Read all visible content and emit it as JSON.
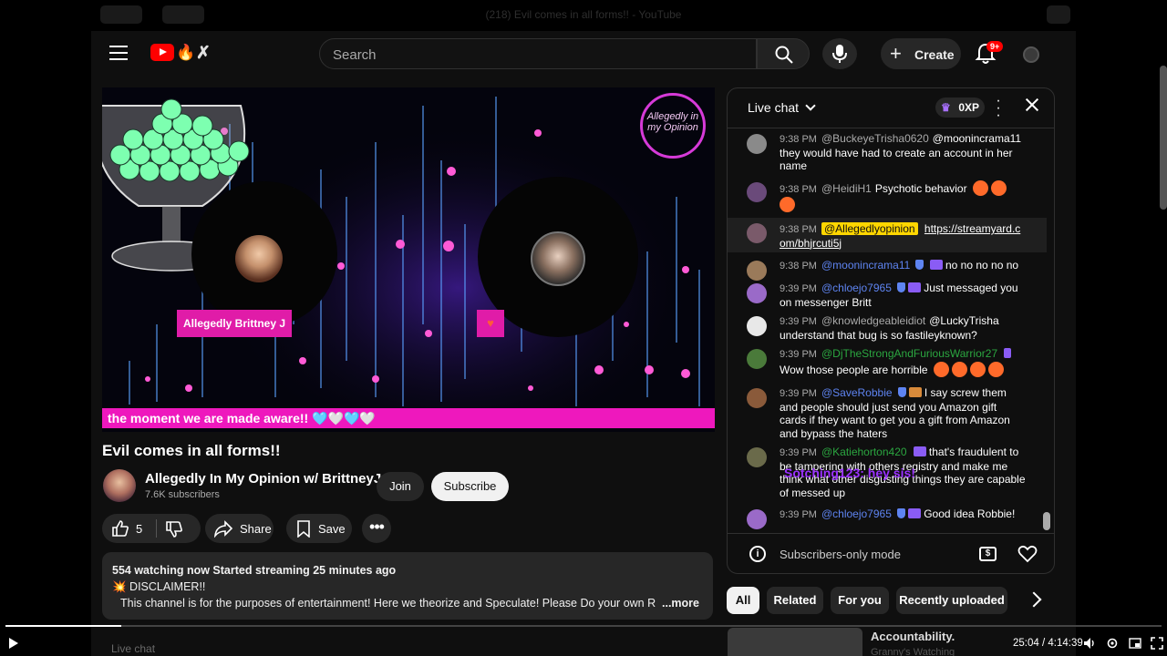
{
  "browser": {
    "tab_title": "(218) Evil comes in all forms!! - YouTube"
  },
  "masthead": {
    "search_placeholder": "Search",
    "create_label": "Create",
    "notifications_badge": "9+"
  },
  "video": {
    "name_tag": "Allegedly Brittney J",
    "ticker_text": "the moment we are made aware!! 🩵🤍🩵🤍",
    "corner_logo": "Allegedly in my Opinion"
  },
  "meta": {
    "title": "Evil comes in all forms!!",
    "channel_name": "Allegedly In My Opinion w/ BrittneyJ",
    "subscribers": "7.6K subscribers",
    "join_label": "Join",
    "subscribe_label": "Subscribe",
    "like_count": "5",
    "share_label": "Share",
    "save_label": "Save"
  },
  "description": {
    "stats": "554 watching now  Started streaming 25 minutes ago",
    "line1": "💥 DISCLAIMER!!",
    "line2": "This channel is for the purposes of entertainment!  Here we theorize and Speculate!  Please Do your own R",
    "more_label": "...more"
  },
  "below_label": "Live chat",
  "chat": {
    "title": "Live chat",
    "xp": "0XP",
    "footer_label": "Subscribers-only mode",
    "overlay_text": "Sotching123: hey sis!",
    "messages": [
      {
        "time": "9:38 PM",
        "author": "@BuckeyeTrisha0620",
        "text": "@moonincrama11 they would have had to create an account in her name"
      },
      {
        "time": "9:38 PM",
        "author": "@HeidiH1",
        "text": "Psychotic behavior"
      },
      {
        "time": "9:38 PM",
        "author": "@Allegedlyopinion",
        "text": "https://streamyard.com/bhjrcuti5j"
      },
      {
        "time": "9:38 PM",
        "author": "@moonincrama11",
        "text": "no no no no no"
      },
      {
        "time": "9:39 PM",
        "author": "@chloejo7965",
        "text": "Just messaged you on messenger Britt"
      },
      {
        "time": "9:39 PM",
        "author": "@knowledgeableidiot",
        "text": "@LuckyTrisha understand that bug is so fastileyknown?"
      },
      {
        "time": "9:39 PM",
        "author": "@DjTheStrongAndFuriousWarrior27",
        "text": "Wow those people are horrible"
      },
      {
        "time": "9:39 PM",
        "author": "@SaveRobbie",
        "text": "I say screw them and people should just send you Amazon gift cards if they want to get you a gift from Amazon and bypass the haters"
      },
      {
        "time": "9:39 PM",
        "author": "@Katiehorton420",
        "text": "that's fraudulent to be tampering with others registry and make me think what other disgusting things they are capable of messed up"
      },
      {
        "time": "9:39 PM",
        "author": "@chloejo7965",
        "text": "Good idea Robbie!"
      }
    ]
  },
  "chips": [
    "All",
    "Related",
    "For you",
    "Recently uploaded"
  ],
  "recommendation": {
    "title": "Accountability.",
    "channel": "Granny's Watching"
  },
  "player": {
    "timecode": "25:04 / 4:14:39",
    "progress": 0.1
  }
}
